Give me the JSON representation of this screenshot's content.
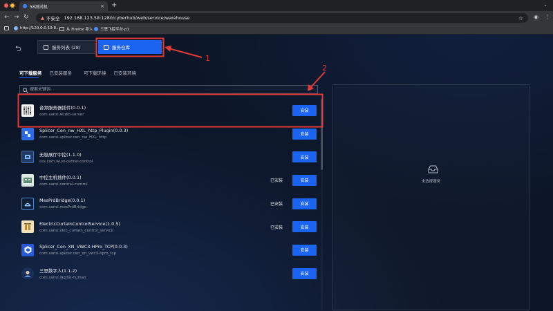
{
  "browser": {
    "tab_title": "58测试机",
    "tab_close": "×",
    "new_tab": "+",
    "secure_label": "不安全",
    "url": "192.168.123.58:1280/cyberhub/web/service/warehouse",
    "bookmarks": [
      {
        "label": "http://129.0.0.19:8..."
      },
      {
        "label": "从 Firefox 导入"
      },
      {
        "label": "三思飞控平台-p1"
      }
    ]
  },
  "app": {
    "top_tabs": [
      {
        "label": "服务列表 (28)"
      },
      {
        "label": "服务仓库"
      }
    ],
    "subtabs": [
      {
        "label": "可下载服务"
      },
      {
        "label": "已安装服务"
      },
      {
        "label": "可下载环境"
      },
      {
        "label": "已安装环境"
      }
    ],
    "search": {
      "placeholder": "搜索关键词"
    },
    "items": [
      {
        "name": "音频服务器插件(0.0.1)",
        "pkg": "com.sansi.Audio-server",
        "installed": "",
        "button": "安装",
        "icon": "audio-mixer-icon"
      },
      {
        "name": "Splicer_Cen_nw_HXL_http_Plugin(0.0.3)",
        "pkg": "com.sansi.splicer.cen_nw_HXL_http",
        "installed": "",
        "button": "安装",
        "icon": "splicer-icon"
      },
      {
        "name": "无极展厅中控(1.1.0)",
        "pkg": "ccs.com.wuxi-center-control",
        "installed": "",
        "button": "安装",
        "icon": "control-center-icon"
      },
      {
        "name": "中控主机插件(0.0.1)",
        "pkg": "com.sansi.central-control",
        "installed": "已安装",
        "button": "安装",
        "icon": "central-host-icon"
      },
      {
        "name": "MesPrdBridge(0.0.1)",
        "pkg": "com.sansi.mesPrdBridge",
        "installed": "已安装",
        "button": "安装",
        "icon": "bridge-icon"
      },
      {
        "name": "ElectricCurtainControlService(1.0.5)",
        "pkg": "com.sansi.elec_curtain_control_service",
        "installed": "已安装",
        "button": "安装",
        "icon": "curtain-icon"
      },
      {
        "name": "Splicer_Cen_XN_VWC3-HPro_TCP(0.0.3)",
        "pkg": "com.sansi.splicer.cen_xn_vwc3-hpro_tcp",
        "installed": "",
        "button": "安装",
        "icon": "hexagon-icon"
      },
      {
        "name": "三思数字人(1.1.2)",
        "pkg": "com.sansi.digital-human",
        "installed": "",
        "button": "安装",
        "icon": "digital-human-icon"
      }
    ],
    "detail": {
      "empty_text": "未选择服务"
    },
    "annotations": [
      "1",
      "2"
    ]
  },
  "colors": {
    "accent": "#1b64f2",
    "annotation": "#e53935"
  }
}
